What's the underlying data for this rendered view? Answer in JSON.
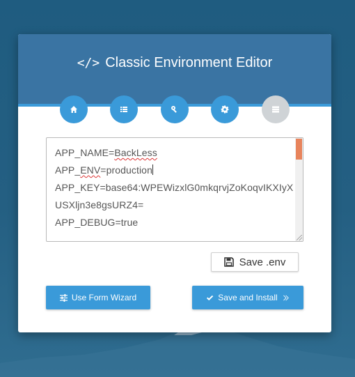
{
  "header": {
    "icon": "code-icon",
    "title": "Classic Environment Editor",
    "steps": [
      {
        "icon": "home-icon",
        "state": "active"
      },
      {
        "icon": "list-icon",
        "state": "active"
      },
      {
        "icon": "key-icon",
        "state": "active"
      },
      {
        "icon": "gear-icon",
        "state": "active"
      },
      {
        "icon": "server-icon",
        "state": "inactive"
      }
    ]
  },
  "editor": {
    "lines": [
      {
        "prefix": "APP_NAME=",
        "flagged": "BackLess",
        "suffix": ""
      },
      {
        "prefix": "APP_",
        "flagged": "ENV",
        "suffix": "=production"
      },
      {
        "prefix": "",
        "flagged": "",
        "suffix": "APP_KEY=base64:WPEWizxlG0mkqrvjZoKoqvIKXIyX"
      },
      {
        "prefix": "",
        "flagged": "",
        "suffix": "USXljn3e8gsURZ4="
      },
      {
        "prefix": "",
        "flagged": "",
        "suffix": "APP_DEBUG=true"
      }
    ]
  },
  "actions": {
    "save_env_label": "Save .env",
    "wizard_label": "Use Form Wizard",
    "install_label": "Save and Install"
  },
  "colors": {
    "accent": "#3a9ad9",
    "header": "#3a74a3",
    "scroll_thumb": "#e8845c",
    "inactive_step": "#cfd3d6"
  }
}
